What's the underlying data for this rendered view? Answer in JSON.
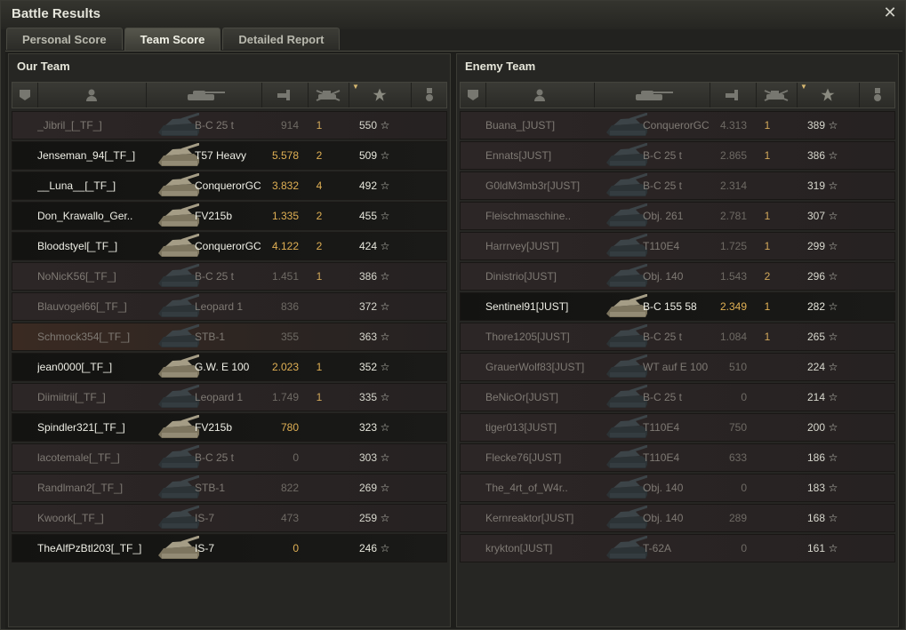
{
  "window": {
    "title": "Battle Results"
  },
  "tabs": [
    "Personal Score",
    "Team Score",
    "Detailed Report"
  ],
  "active_tab": 1,
  "our_team": {
    "title": "Our Team",
    "players": [
      {
        "name": "_Jibril_[_TF_]",
        "tank": "B-C 25 t",
        "damage": "914",
        "kills": "1",
        "xp": "550",
        "alive": false,
        "highlight": false
      },
      {
        "name": "Jenseman_94[_TF_]",
        "tank": "T57 Heavy",
        "damage": "5.578",
        "kills": "2",
        "xp": "509",
        "alive": true,
        "highlight": false
      },
      {
        "name": "__Luna__[_TF_]",
        "tank": "ConquerorGC",
        "damage": "3.832",
        "kills": "4",
        "xp": "492",
        "alive": true,
        "highlight": false
      },
      {
        "name": "Don_Krawallo_Ger..",
        "tank": "FV215b",
        "damage": "1.335",
        "kills": "2",
        "xp": "455",
        "alive": true,
        "highlight": false
      },
      {
        "name": "Bloodstyel[_TF_]",
        "tank": "ConquerorGC",
        "damage": "4.122",
        "kills": "2",
        "xp": "424",
        "alive": true,
        "highlight": false
      },
      {
        "name": "NoNicK56[_TF_]",
        "tank": "B-C 25 t",
        "damage": "1.451",
        "kills": "1",
        "xp": "386",
        "alive": false,
        "highlight": false
      },
      {
        "name": "Blauvogel66[_TF_]",
        "tank": "Leopard 1",
        "damage": "836",
        "kills": "",
        "xp": "372",
        "alive": false,
        "highlight": false
      },
      {
        "name": "Schmock354[_TF_]",
        "tank": "STB-1",
        "damage": "355",
        "kills": "",
        "xp": "363",
        "alive": false,
        "highlight": true
      },
      {
        "name": "jean0000[_TF_]",
        "tank": "G.W. E 100",
        "damage": "2.023",
        "kills": "1",
        "xp": "352",
        "alive": true,
        "highlight": false
      },
      {
        "name": "Diimiitrii[_TF_]",
        "tank": "Leopard 1",
        "damage": "1.749",
        "kills": "1",
        "xp": "335",
        "alive": false,
        "highlight": false
      },
      {
        "name": "Spindler321[_TF_]",
        "tank": "FV215b",
        "damage": "780",
        "kills": "",
        "xp": "323",
        "alive": true,
        "highlight": false
      },
      {
        "name": "lacotemale[_TF_]",
        "tank": "B-C 25 t",
        "damage": "0",
        "kills": "",
        "xp": "303",
        "alive": false,
        "highlight": false
      },
      {
        "name": "Randlman2[_TF_]",
        "tank": "STB-1",
        "damage": "822",
        "kills": "",
        "xp": "269",
        "alive": false,
        "highlight": false
      },
      {
        "name": "Kwoork[_TF_]",
        "tank": "IS-7",
        "damage": "473",
        "kills": "",
        "xp": "259",
        "alive": false,
        "highlight": false
      },
      {
        "name": "TheAlfPzBtl203[_TF_]",
        "tank": "IS-7",
        "damage": "0",
        "kills": "",
        "xp": "246",
        "alive": true,
        "highlight": false
      }
    ]
  },
  "enemy_team": {
    "title": "Enemy Team",
    "players": [
      {
        "name": "Buana_[JUST]",
        "tank": "ConquerorGC",
        "damage": "4.313",
        "kills": "1",
        "xp": "389",
        "alive": false,
        "highlight": false
      },
      {
        "name": "Ennats[JUST]",
        "tank": "B-C 25 t",
        "damage": "2.865",
        "kills": "1",
        "xp": "386",
        "alive": false,
        "highlight": false
      },
      {
        "name": "G0ldM3mb3r[JUST]",
        "tank": "B-C 25 t",
        "damage": "2.314",
        "kills": "",
        "xp": "319",
        "alive": false,
        "highlight": false
      },
      {
        "name": "Fleischmaschine..",
        "tank": "Obj. 261",
        "damage": "2.781",
        "kills": "1",
        "xp": "307",
        "alive": false,
        "highlight": false
      },
      {
        "name": "Harrrvey[JUST]",
        "tank": "T110E4",
        "damage": "1.725",
        "kills": "1",
        "xp": "299",
        "alive": false,
        "highlight": false
      },
      {
        "name": "Dinistrio[JUST]",
        "tank": "Obj. 140",
        "damage": "1.543",
        "kills": "2",
        "xp": "296",
        "alive": false,
        "highlight": false
      },
      {
        "name": "Sentinel91[JUST]",
        "tank": "B-C 155 58",
        "damage": "2.349",
        "kills": "1",
        "xp": "282",
        "alive": true,
        "highlight": false
      },
      {
        "name": "Thore1205[JUST]",
        "tank": "B-C 25 t",
        "damage": "1.084",
        "kills": "1",
        "xp": "265",
        "alive": false,
        "highlight": false
      },
      {
        "name": "GrauerWolf83[JUST]",
        "tank": "WT auf E 100",
        "damage": "510",
        "kills": "",
        "xp": "224",
        "alive": false,
        "highlight": false
      },
      {
        "name": "BeNicOr[JUST]",
        "tank": "B-C 25 t",
        "damage": "0",
        "kills": "",
        "xp": "214",
        "alive": false,
        "highlight": false
      },
      {
        "name": "tiger013[JUST]",
        "tank": "T110E4",
        "damage": "750",
        "kills": "",
        "xp": "200",
        "alive": false,
        "highlight": false
      },
      {
        "name": "Flecke76[JUST]",
        "tank": "T110E4",
        "damage": "633",
        "kills": "",
        "xp": "186",
        "alive": false,
        "highlight": false
      },
      {
        "name": "The_4rt_of_W4r..",
        "tank": "Obj. 140",
        "damage": "0",
        "kills": "",
        "xp": "183",
        "alive": false,
        "highlight": false
      },
      {
        "name": "Kernreaktor[JUST]",
        "tank": "Obj. 140",
        "damage": "289",
        "kills": "",
        "xp": "168",
        "alive": false,
        "highlight": false
      },
      {
        "name": "krykton[JUST]",
        "tank": "T-62A",
        "damage": "0",
        "kills": "",
        "xp": "161",
        "alive": false,
        "highlight": false
      }
    ]
  },
  "columns": [
    {
      "key": "squad",
      "icon": "squad-icon"
    },
    {
      "key": "player",
      "icon": "player-icon"
    },
    {
      "key": "tank",
      "icon": "tank-icon"
    },
    {
      "key": "damage",
      "icon": "damage-icon"
    },
    {
      "key": "kills",
      "icon": "kills-icon"
    },
    {
      "key": "xp",
      "icon": "xp-star-icon",
      "sorted": true
    },
    {
      "key": "medal",
      "icon": "medal-icon"
    }
  ],
  "star_glyph": "☆",
  "colors": {
    "alive_value": "#e0b054",
    "xp": "#e8e8dd",
    "dead_text": "#7f7a74"
  }
}
